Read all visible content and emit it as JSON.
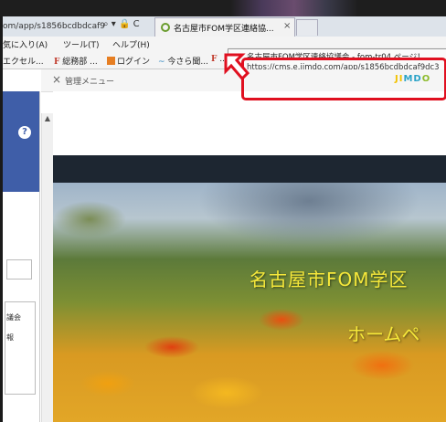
{
  "browser": {
    "url_fragment": "om/app/s1856bcdbdcaf9",
    "address_icons": "⌕ ▾ 🔒 C",
    "tab_title": "名古屋市FOM学区連絡協...",
    "tab_close": "×"
  },
  "menu": {
    "items": [
      "気に入り(A)",
      "ツール(T)",
      "ヘルプ(H)"
    ]
  },
  "favorites": {
    "items": [
      {
        "prefix": "",
        "label": "エクセル..."
      },
      {
        "prefix": "F",
        "label": "総務部 ..."
      },
      {
        "prefix": "grid",
        "label": "ログイン"
      },
      {
        "prefix": "~",
        "label": "今さら聞..."
      },
      {
        "prefix": "F",
        "label": "..."
      }
    ]
  },
  "tooltip": {
    "line1": "名古屋市FOM学区連絡協議会 - fom-tr04 ページ！",
    "line2": "https://cms.e.jimdo.com/app/s1856bcdbdcaf9dc3"
  },
  "admin": {
    "close": "×",
    "label": "管理メニュー",
    "logo": "JIMDO"
  },
  "left_panel": {
    "help": "?",
    "text1": "議会",
    "text2": "報"
  },
  "scrollbar": {
    "up": "▲"
  },
  "hero": {
    "title": "名古屋市FOM学区",
    "subtitle": "ホームペ"
  },
  "colors": {
    "accent_blue": "#3f5ea8",
    "highlight_red": "#e01020",
    "hero_text": "#f6e83a"
  }
}
